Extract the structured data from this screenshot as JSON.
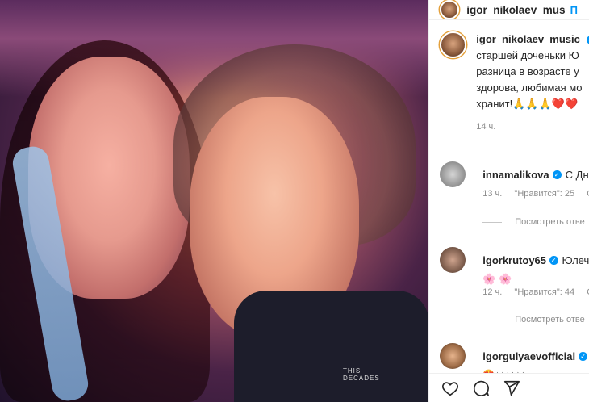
{
  "header": {
    "username": "igor_nikolaev_mus",
    "follow_label": "П"
  },
  "caption": {
    "username": "igor_nikolaev_music",
    "lines": [
      "старшей доченьки Ю",
      "разница в возрасте у",
      "здорова, любимая мо",
      "хранит!🙏🙏🙏❤️❤️"
    ],
    "time": "14 ч."
  },
  "comments": [
    {
      "username": "innamalikova",
      "text": "С Дн",
      "time": "13 ч.",
      "likes": "\"Нравится\": 25",
      "reply_label": "С"
    },
    {
      "username": "igorkrutoy65",
      "text": "Юлеч",
      "text2": "🌸 🌸",
      "time": "12 ч.",
      "likes": "\"Нравится\": 44",
      "reply_label": "С"
    },
    {
      "username": "igorgulyaevofficial",
      "text2": "😍♠♠♠♠♠♠"
    }
  ],
  "replies": [
    {
      "label": "Посмотреть отве"
    },
    {
      "label": "Посмотреть отве"
    }
  ],
  "photo": {
    "shirt_text_1": "THIS",
    "shirt_text_2": "DECADES"
  },
  "icons": {
    "like": "heart-icon",
    "comment": "comment-icon",
    "share": "share-icon"
  },
  "colors": {
    "accent": "#0095f6",
    "meta": "#8e8e8e",
    "border": "#efefef"
  }
}
